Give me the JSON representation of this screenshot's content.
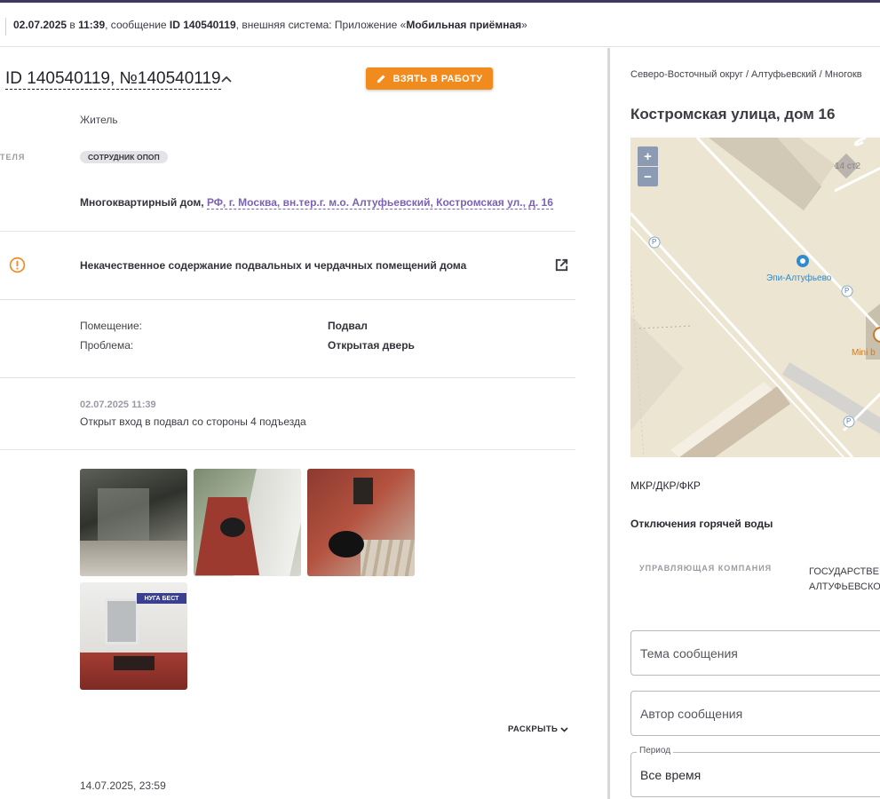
{
  "header": {
    "date": "02.07.2025",
    "in": " в ",
    "time": "11:39",
    "msg_prefix": ", сообщение ",
    "msg_id": "ID 140540119",
    "ext_prefix": ", внешняя система: Приложение «",
    "ext_name": "Мобильная приёмная",
    "ext_suffix": "»"
  },
  "ticket": {
    "title": "ID 140540119, №140540119",
    "take_button": "ВЗЯТЬ В РАБОТУ",
    "applicant_type": "Житель",
    "applicant_label_fragment": "ТЕЛЯ",
    "badge": "СОТРУДНИК ОПОП",
    "address_type": "Многоквартирный дом,",
    "address_link": "РФ, г. Москва, вн.тер.г. м.о. Алтуфьевский, Костромская ул., д. 16",
    "problem": "Некачественное содержание подвальных и чердачных помещений дома",
    "details": [
      {
        "label": "Помещение:",
        "value": "Подвал"
      },
      {
        "label": "Проблема:",
        "value": "Открытая дверь"
      }
    ],
    "message_date": "02.07.2025 11:39",
    "message_text": "Открыт вход в подвал со стороны 4 подъезда",
    "photo_sign_text": "НУГА БЕСТ",
    "expand_label": "РАСКРЫТЬ",
    "next_date": "14.07.2025, 23:59"
  },
  "right": {
    "breadcrumb": "Северо-Восточный округ / Алтуфьевский / Многокв",
    "street": "Костромская улица, дом 16",
    "map": {
      "zoom_in": "+",
      "zoom_out": "−",
      "label_building": "14 ст2",
      "label_poi": "Эпи-Алтуфьево",
      "label_shop": "Mini b",
      "parking": "P"
    },
    "section_mkr": "МКР/ДКР/ФКР",
    "section_hot_water": "Отключения горячей воды",
    "uk_label": "УПРАВЛЯЮЩАЯ КОМПАНИЯ",
    "uk_value_line1": "ГОСУДАРСТВЕ",
    "uk_value_line2": "АЛТУФЬЕВСКО",
    "filters": {
      "topic_placeholder": "Тема сообщения",
      "author_placeholder": "Автор сообщения",
      "period_legend": "Период",
      "period_value": "Все время"
    }
  }
}
